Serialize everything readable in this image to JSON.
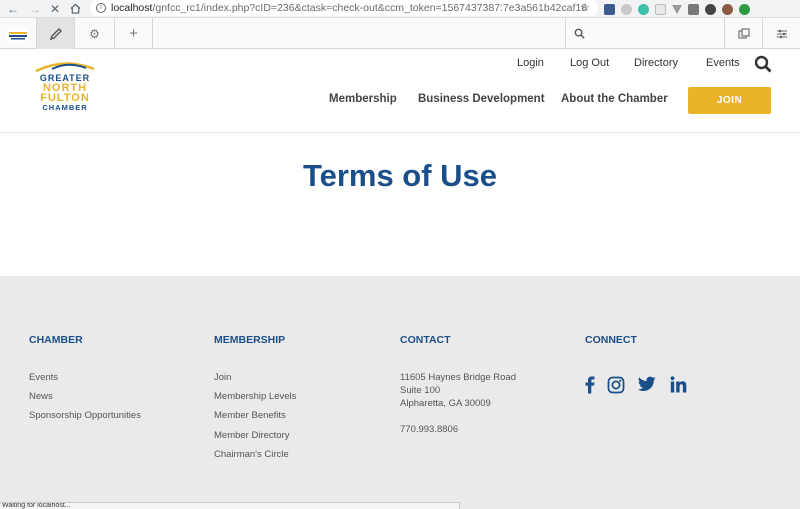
{
  "browser": {
    "url_host": "localhost",
    "url_path": "/gnfcc_rc1/index.php?cID=236&ctask=check-out&ccm_token=1567437387:7e3a561b42caf183…"
  },
  "logo": {
    "line1": "GREATER",
    "line2": "NORTH",
    "line3": "FULTON",
    "line4": "CHAMBER"
  },
  "top_nav": [
    "Login",
    "Log Out",
    "Directory",
    "Events"
  ],
  "main_nav": [
    "Membership",
    "Business Development",
    "About the Chamber"
  ],
  "join_label": "JOIN",
  "page_title": "Terms of Use",
  "footer": {
    "chamber": {
      "heading": "CHAMBER",
      "links": [
        "Events",
        "News",
        "Sponsorship Opportunities"
      ]
    },
    "membership": {
      "heading": "MEMBERSHIP",
      "links": [
        "Join",
        "Membership Levels",
        "Member Benefits",
        "Member Directory",
        "Chairman's Circle"
      ]
    },
    "contact": {
      "heading": "CONTACT",
      "address1": "11605 Haynes Bridge Road",
      "address2": "Suite 100",
      "address3": "Alpharetta, GA 30009",
      "phone": "770.993.8806"
    },
    "connect": {
      "heading": "CONNECT",
      "icons": [
        "facebook-icon",
        "instagram-icon",
        "twitter-icon",
        "linkedin-icon"
      ]
    }
  },
  "status_text": "Waiting for localhost...",
  "colors": {
    "brand_blue": "#1b4f8a",
    "join_yellow": "#e9b42a",
    "footer_bg": "#eaeaea"
  }
}
